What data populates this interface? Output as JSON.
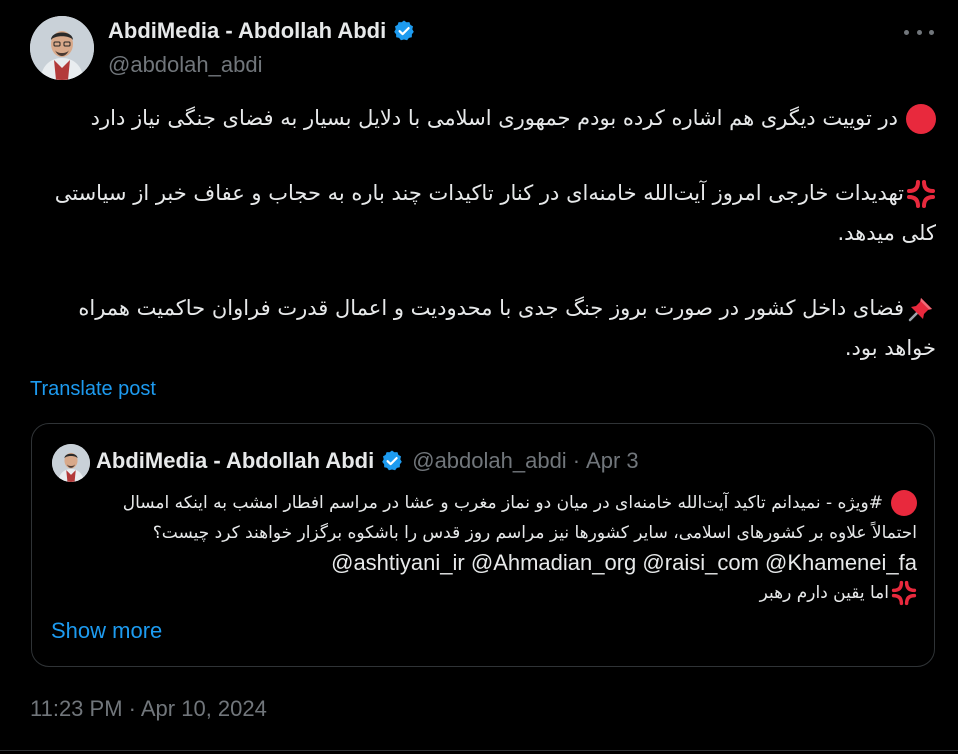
{
  "author": {
    "name": "AbdiMedia - Abdollah Abdi",
    "handle": "@abdolah_abdi",
    "verified": true
  },
  "post": {
    "paragraphs": [
      {
        "icon": "red-circle-emoji",
        "lines": [
          "در توییت دیگری هم اشاره کرده بودم جمهوری اسلامی با دلایل بسیار به فضای جنگی نیاز دارد"
        ]
      },
      {
        "icon": "anger-symbol-emoji",
        "lines": [
          "تهدیدات خارجی امروز آیت‌الله خامنه‌ای در کنار تاکیدات چند باره به حجاب و عفاف خبر از سیاستی",
          "کلی میدهد."
        ]
      },
      {
        "icon": "pushpin-emoji",
        "lines": [
          "فضای داخل کشور در صورت بروز جنگ جدی با محدودیت و اعمال قدرت فراوان حاکمیت همراه",
          "خواهد بود."
        ]
      }
    ],
    "translate_label": "Translate post",
    "timestamp": "11:23 PM · Apr 10, 2024"
  },
  "quote": {
    "name": "AbdiMedia - Abdollah Abdi",
    "handle": "@abdolah_abdi",
    "dot": "·",
    "date": "Apr 3",
    "line1": "#ویژه - نمیدانم تاکید آیت‌الله خامنه‌ای در میان دو نماز مغرب و عشا در مراسم افطار امشب به اینکه امسال",
    "line2": "احتمالاً علاوه بر کشورهای اسلامی، سایر کشورها نیز مراسم روز قدس را باشکوه برگزار خواهند کرد چیست؟",
    "mentions": [
      "@ashtiyani_ir",
      "@Ahmadian_org",
      "@raisi_com",
      "@Khamenei_fa"
    ],
    "line4": "اما یقین دارم رهبر",
    "show_more_label": "Show more"
  },
  "colors": {
    "background": "#000000",
    "text": "#e7e9ea",
    "muted": "#71767b",
    "link": "#1d9bf0",
    "border": "#2f3336",
    "verified": "#1d9bf0",
    "red_circle": "#e8293d"
  }
}
